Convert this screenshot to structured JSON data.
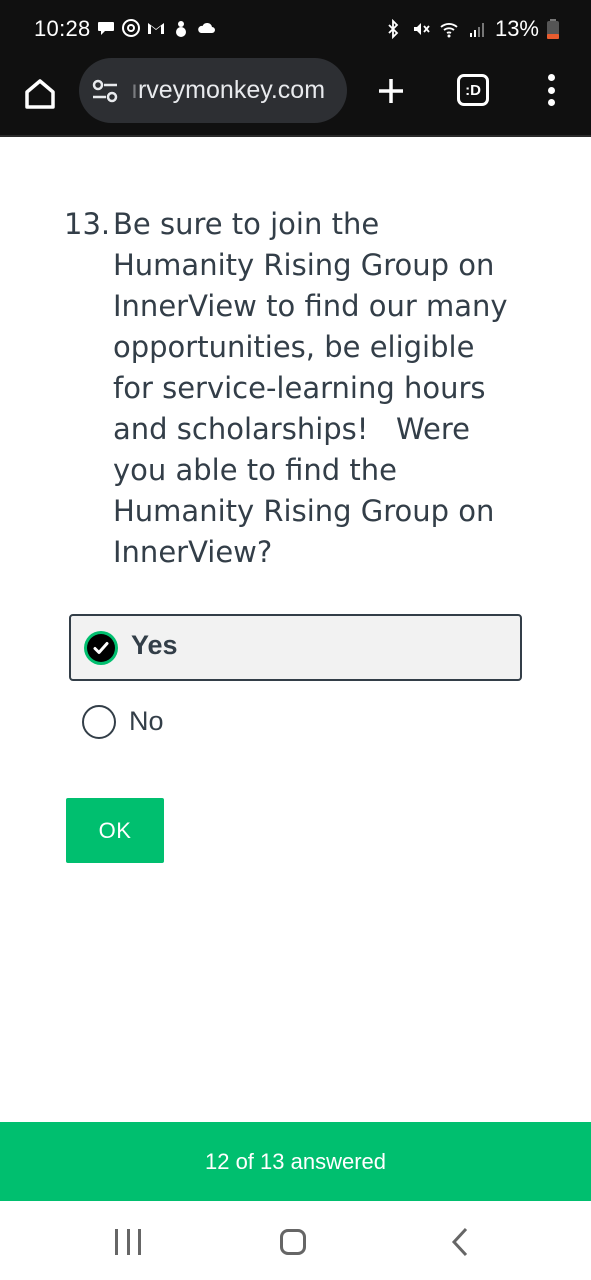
{
  "status_bar": {
    "time": "10:28",
    "battery": "13%",
    "left_icons": [
      "chat-bubble-icon",
      "threads-icon",
      "gmail-icon",
      "snowman-icon",
      "cloud-icon"
    ],
    "right_icons": [
      "bluetooth-icon",
      "mute-icon",
      "wifi-icon",
      "signal-icon",
      "battery-icon"
    ],
    "battery_color": "#e85c2f"
  },
  "browser": {
    "url_faded": "ı",
    "url": "rveymonkey.com",
    "tabs_label": ":D"
  },
  "question": {
    "number": "13.",
    "text": "Be sure to join the Humanity Rising Group on InnerView to find our many opportunities, be eligible for service-learning hours and scholarships!   Were you able to find the Humanity Rising Group on InnerView?"
  },
  "options": [
    {
      "label": "Yes",
      "selected": true
    },
    {
      "label": "No",
      "selected": false
    }
  ],
  "ok_label": "OK",
  "progress": {
    "label": "12 of 13 answered",
    "answered": 12,
    "total": 13
  },
  "colors": {
    "accent": "#00bf6f",
    "text": "#333e48",
    "statusbar_bg": "#101010"
  }
}
